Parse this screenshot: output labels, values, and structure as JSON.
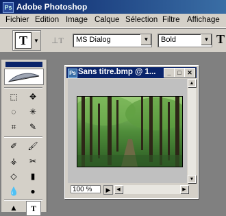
{
  "app": {
    "title": "Adobe Photoshop",
    "icon_letters": "Ps"
  },
  "menu": [
    "Fichier",
    "Edition",
    "Image",
    "Calque",
    "Sélection",
    "Filtre",
    "Affichage"
  ],
  "options": {
    "tool_glyph": "T",
    "orientation_glyph": "⊥T",
    "font_family": "MS Dialog",
    "font_style": "Bold",
    "right_glyph": "T"
  },
  "toolbox": {
    "tools": [
      "⬚",
      "✥",
      "◌",
      "✳",
      "⌗",
      "✎",
      "✐",
      "🖌",
      "⚶",
      "✂",
      "◇",
      "▮",
      "💧",
      "●",
      "▲",
      "T"
    ]
  },
  "document": {
    "title": "Sans titre.bmp @ 1...",
    "zoom": "100 %"
  },
  "colors": {
    "title_dark": "#0a246a",
    "title_light": "#3a6ea5",
    "chrome": "#d4d0c8",
    "workspace": "#808080"
  }
}
